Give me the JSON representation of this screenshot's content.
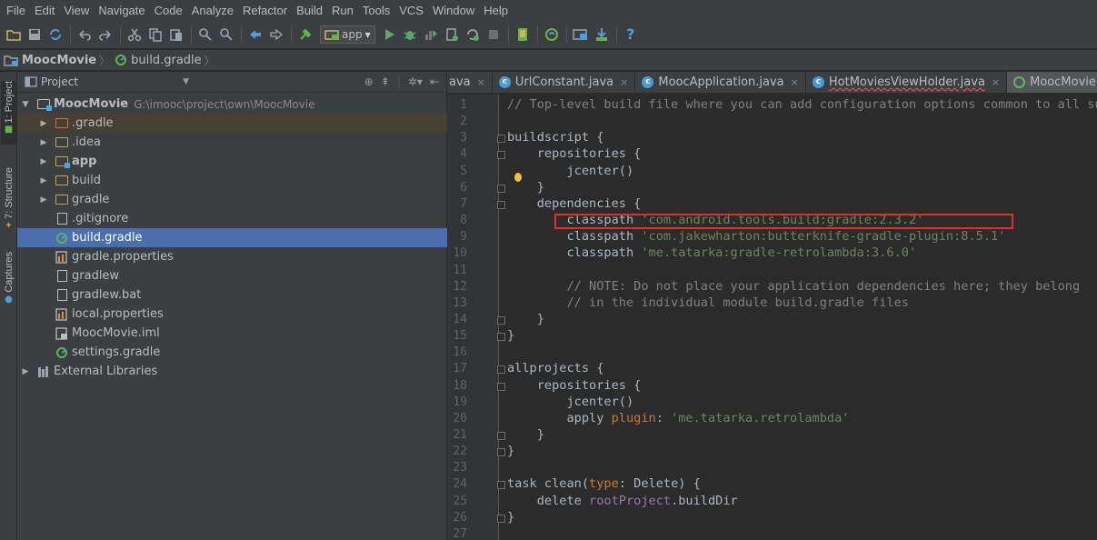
{
  "menu": [
    "File",
    "Edit",
    "View",
    "Navigate",
    "Code",
    "Analyze",
    "Refactor",
    "Build",
    "Run",
    "Tools",
    "VCS",
    "Window",
    "Help"
  ],
  "toolbar": {
    "run_config": "app"
  },
  "breadcrumb": [
    "MoocMovie",
    "build.gradle"
  ],
  "left_strip": [
    "1: Project",
    "7: Structure",
    "Captures"
  ],
  "project_panel": {
    "title": "Project",
    "tree": [
      {
        "label": "MoocMovie",
        "path": "G:\\imooc\\project\\own\\MoocMovie"
      },
      {
        "label": ".gradle"
      },
      {
        "label": ".idea"
      },
      {
        "label": "app"
      },
      {
        "label": "build"
      },
      {
        "label": "gradle"
      },
      {
        "label": ".gitignore"
      },
      {
        "label": "build.gradle"
      },
      {
        "label": "gradle.properties"
      },
      {
        "label": "gradlew"
      },
      {
        "label": "gradlew.bat"
      },
      {
        "label": "local.properties"
      },
      {
        "label": "MoocMovie.iml"
      },
      {
        "label": "settings.gradle"
      },
      {
        "label": "External Libraries"
      }
    ]
  },
  "tabs": [
    {
      "label": "ava"
    },
    {
      "label": "UrlConstant.java"
    },
    {
      "label": "MoocApplication.java"
    },
    {
      "label": "HotMoviesViewHolder.java"
    },
    {
      "label": "MoocMovie"
    }
  ],
  "editor": {
    "line_numbers": [
      "1",
      "2",
      "3",
      "4",
      "5",
      "6",
      "7",
      "8",
      "9",
      "10",
      "11",
      "12",
      "13",
      "14",
      "15",
      "16",
      "17",
      "18",
      "19",
      "20",
      "21",
      "22",
      "23",
      "24",
      "25",
      "26",
      "27"
    ],
    "lines": [
      [
        [
          "com",
          "// Top-level build file where you can add configuration options common to all sub"
        ]
      ],
      [],
      [
        [
          "txt",
          "buildscript {"
        ]
      ],
      [
        [
          "txt",
          "    repositories {"
        ]
      ],
      [
        [
          "txt",
          "        jcenter()"
        ]
      ],
      [
        [
          "txt",
          "    }"
        ]
      ],
      [
        [
          "txt",
          "    dependencies {"
        ]
      ],
      [
        [
          "txt",
          "        classpath "
        ],
        [
          "str",
          "'com.android.tools.build:gradle:2.3.2'"
        ]
      ],
      [
        [
          "txt",
          "        classpath "
        ],
        [
          "str",
          "'com.jakewharton:butterknife-gradle-plugin:8.5.1'"
        ]
      ],
      [
        [
          "txt",
          "        classpath "
        ],
        [
          "str",
          "'me.tatarka:gradle-retrolambda:3.6.0'"
        ]
      ],
      [],
      [
        [
          "com",
          "        // NOTE: Do not place your application dependencies here; they belong"
        ]
      ],
      [
        [
          "com",
          "        // in the individual module build.gradle files"
        ]
      ],
      [
        [
          "txt",
          "    }"
        ]
      ],
      [
        [
          "txt",
          "}"
        ]
      ],
      [],
      [
        [
          "txt",
          "allprojects {"
        ]
      ],
      [
        [
          "txt",
          "    repositories {"
        ]
      ],
      [
        [
          "txt",
          "        jcenter()"
        ]
      ],
      [
        [
          "txt",
          "        apply "
        ],
        [
          "kw",
          "plugin"
        ],
        [
          "txt",
          ": "
        ],
        [
          "str",
          "'me.tatarka.retrolambda'"
        ]
      ],
      [
        [
          "txt",
          "    }"
        ]
      ],
      [
        [
          "txt",
          "}"
        ]
      ],
      [],
      [
        [
          "txt",
          "task clean("
        ],
        [
          "kw",
          "type"
        ],
        [
          "txt",
          ": Delete) {"
        ]
      ],
      [
        [
          "txt",
          "    delete "
        ],
        [
          "id",
          "rootProject"
        ],
        [
          "txt",
          ".buildDir"
        ]
      ],
      [
        [
          "txt",
          "}"
        ]
      ],
      []
    ]
  },
  "colors": {
    "selection": "#4b6eaf",
    "highlight_box": "#e0302a"
  }
}
